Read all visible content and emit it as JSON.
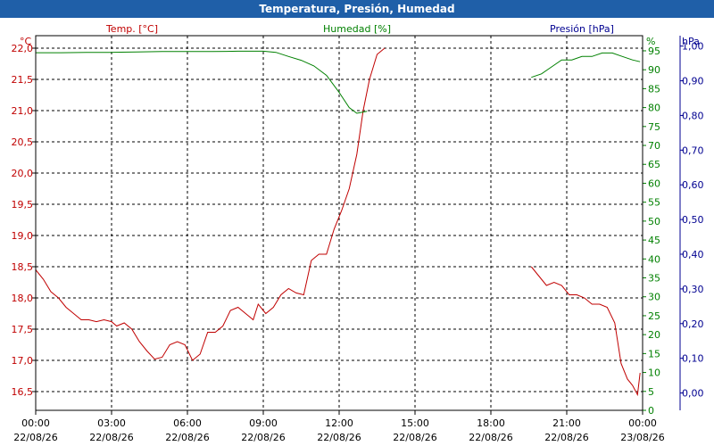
{
  "chart_data": {
    "type": "line",
    "title": "Temperatura, Presión, Humedad",
    "legend": {
      "temp": "Temp. [°C]",
      "hum": "Humedad [%]",
      "pres": "Presión [hPa]"
    },
    "units": {
      "temp": "°C",
      "hum": "%",
      "pres": "hPa"
    },
    "colors": {
      "temp": "#c00000",
      "hum": "#008000",
      "pres": "#000090",
      "grid": "#000000"
    },
    "x_ticks": [
      {
        "time": "00:00",
        "date": "22/08/26"
      },
      {
        "time": "03:00",
        "date": "22/08/26"
      },
      {
        "time": "06:00",
        "date": "22/08/26"
      },
      {
        "time": "09:00",
        "date": "22/08/26"
      },
      {
        "time": "12:00",
        "date": "22/08/26"
      },
      {
        "time": "15:00",
        "date": "22/08/26"
      },
      {
        "time": "18:00",
        "date": "22/08/26"
      },
      {
        "time": "21:00",
        "date": "22/08/26"
      },
      {
        "time": "00:00",
        "date": "23/08/26"
      }
    ],
    "xlim_hours": [
      0,
      24
    ],
    "temp_axis": {
      "ylim": [
        16.2,
        22.2
      ],
      "ticks": [
        "22,0",
        "21,5",
        "21,0",
        "20,5",
        "20,0",
        "19,5",
        "19,0",
        "18,5",
        "18,0",
        "17,5",
        "17,0",
        "16,5"
      ],
      "tick_values": [
        22.0,
        21.5,
        21.0,
        20.5,
        20.0,
        19.5,
        19.0,
        18.5,
        18.0,
        17.5,
        17.0,
        16.5
      ]
    },
    "hum_axis": {
      "ylim": [
        0,
        99
      ],
      "ticks": [
        "95",
        "90",
        "85",
        "80",
        "75",
        "70",
        "65",
        "60",
        "55",
        "50",
        "45",
        "40",
        "35",
        "30",
        "25",
        "20",
        "15",
        "10",
        "5",
        "0"
      ],
      "tick_values": [
        95,
        90,
        85,
        80,
        75,
        70,
        65,
        60,
        55,
        50,
        45,
        40,
        35,
        30,
        25,
        20,
        15,
        10,
        5,
        0
      ]
    },
    "pres_axis": {
      "ylim": [
        -0.05,
        1.03
      ],
      "ticks": [
        "1,00",
        "0,90",
        "0,80",
        "0,70",
        "0,60",
        "0,50",
        "0,40",
        "0,30",
        "0,20",
        "0,10",
        "0,00"
      ],
      "tick_values": [
        1.0,
        0.9,
        0.8,
        0.7,
        0.6,
        0.5,
        0.4,
        0.3,
        0.2,
        0.1,
        0.0
      ]
    },
    "series": [
      {
        "name": "Temp. [°C]",
        "axis": "temp",
        "segments": [
          [
            [
              0,
              18.45
            ],
            [
              0.3,
              18.3
            ],
            [
              0.6,
              18.1
            ],
            [
              0.9,
              18.0
            ],
            [
              1.2,
              17.85
            ],
            [
              1.5,
              17.75
            ],
            [
              1.8,
              17.65
            ],
            [
              2.1,
              17.65
            ],
            [
              2.4,
              17.62
            ],
            [
              2.7,
              17.65
            ],
            [
              3.0,
              17.62
            ],
            [
              3.2,
              17.55
            ],
            [
              3.5,
              17.6
            ],
            [
              3.8,
              17.5
            ],
            [
              4.1,
              17.3
            ],
            [
              4.4,
              17.15
            ],
            [
              4.7,
              17.02
            ],
            [
              5.0,
              17.05
            ],
            [
              5.3,
              17.25
            ],
            [
              5.6,
              17.3
            ],
            [
              5.9,
              17.25
            ],
            [
              6.2,
              17.0
            ],
            [
              6.5,
              17.1
            ],
            [
              6.8,
              17.45
            ],
            [
              7.1,
              17.45
            ],
            [
              7.4,
              17.55
            ],
            [
              7.7,
              17.8
            ],
            [
              8.0,
              17.85
            ],
            [
              8.3,
              17.75
            ],
            [
              8.6,
              17.65
            ],
            [
              8.8,
              17.9
            ],
            [
              9.1,
              17.75
            ],
            [
              9.4,
              17.85
            ],
            [
              9.7,
              18.05
            ],
            [
              10.0,
              18.15
            ],
            [
              10.3,
              18.08
            ],
            [
              10.6,
              18.05
            ],
            [
              10.9,
              18.6
            ],
            [
              11.2,
              18.7
            ],
            [
              11.5,
              18.7
            ],
            [
              11.8,
              19.1
            ],
            [
              12.1,
              19.4
            ],
            [
              12.4,
              19.75
            ],
            [
              12.7,
              20.3
            ],
            [
              12.95,
              21.0
            ],
            [
              13.2,
              21.5
            ],
            [
              13.5,
              21.9
            ],
            [
              13.8,
              22.0
            ]
          ],
          [
            [
              19.6,
              18.5
            ],
            [
              19.9,
              18.35
            ],
            [
              20.2,
              18.2
            ],
            [
              20.5,
              18.25
            ],
            [
              20.8,
              18.2
            ],
            [
              21.1,
              18.05
            ],
            [
              21.4,
              18.05
            ],
            [
              21.7,
              18.0
            ],
            [
              22.0,
              17.9
            ],
            [
              22.3,
              17.9
            ],
            [
              22.6,
              17.85
            ],
            [
              22.9,
              17.6
            ],
            [
              23.15,
              16.95
            ],
            [
              23.4,
              16.7
            ],
            [
              23.6,
              16.6
            ],
            [
              23.8,
              16.45
            ],
            [
              23.9,
              16.8
            ]
          ]
        ]
      },
      {
        "name": "Humedad [%]",
        "axis": "hum",
        "segments": [
          [
            [
              0,
              94.5
            ],
            [
              1,
              94.5
            ],
            [
              2,
              94.6
            ],
            [
              3,
              94.6
            ],
            [
              4,
              94.7
            ],
            [
              5,
              94.8
            ],
            [
              6,
              94.8
            ],
            [
              7,
              94.8
            ],
            [
              8,
              94.9
            ],
            [
              9,
              94.9
            ],
            [
              9.5,
              94.6
            ],
            [
              10,
              93.5
            ],
            [
              10.5,
              92.5
            ],
            [
              11,
              91.0
            ],
            [
              11.5,
              88.5
            ],
            [
              12,
              84.0
            ],
            [
              12.4,
              80.0
            ],
            [
              12.7,
              78.5
            ],
            [
              13.1,
              79.0
            ]
          ],
          [
            [
              19.6,
              0.91
            ],
            [
              20.0,
              0.92
            ],
            [
              20.4,
              0.94
            ],
            [
              20.8,
              0.96
            ],
            [
              21.2,
              0.96
            ],
            [
              21.6,
              0.97
            ],
            [
              22.0,
              0.97
            ],
            [
              22.4,
              0.98
            ],
            [
              22.8,
              0.98
            ],
            [
              23.2,
              0.97
            ],
            [
              23.6,
              0.96
            ],
            [
              23.9,
              0.955
            ]
          ]
        ]
      }
    ]
  }
}
